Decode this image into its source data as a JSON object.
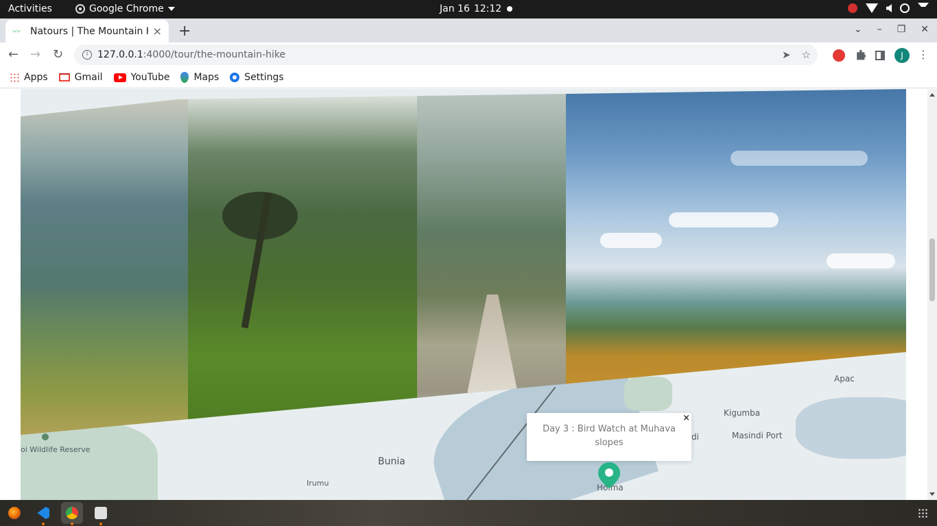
{
  "topbar": {
    "activities": "Activities",
    "app_name": "Google Chrome",
    "date": "Jan 16",
    "time": "12:12"
  },
  "tab": {
    "title": "Natours | The Mountain H",
    "close": "×"
  },
  "toolbar": {
    "url_host": "127.0.0.1",
    "url_path": ":4000/tour/the-mountain-hike",
    "avatar_letter": "J"
  },
  "bookmarks": [
    {
      "label": "Apps",
      "icon": "apps-icon"
    },
    {
      "label": "Gmail",
      "icon": "gmail-icon"
    },
    {
      "label": "YouTube",
      "icon": "youtube-icon"
    },
    {
      "label": "Maps",
      "icon": "maps-icon"
    },
    {
      "label": "Settings",
      "icon": "settings-icon"
    }
  ],
  "map": {
    "labels": {
      "apac": "Apac",
      "kigumba": "Kigumba",
      "masindi_port": "Masindi Port",
      "di": "di",
      "bunia": "Bunia",
      "irumu": "Irumu",
      "hoima": "Hoima",
      "wildlife_reserve": "oi Wildlife Reserve"
    },
    "popup": {
      "text": "Day 3 : Bird Watch at Muhava slopes",
      "close": "×"
    },
    "accent_color": "#55c57a"
  },
  "colors": {
    "brand_green": "#55c57a",
    "topbar_bg": "#1b1b1b"
  }
}
